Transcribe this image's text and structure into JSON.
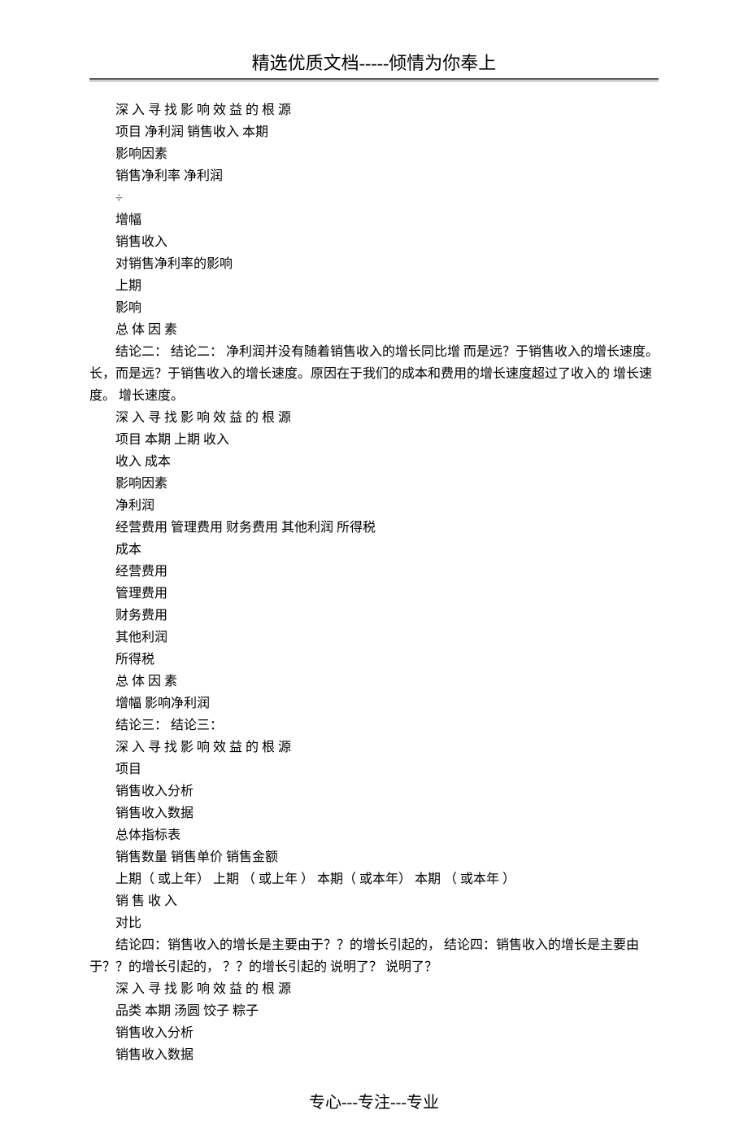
{
  "header": "精选优质文档-----倾情为你奉上",
  "footer": "专心---专注---专业",
  "lines": [
    "深 入 寻 找 影 响 效 益 的 根 源",
    "项目  净利润  销售收入  本期",
    "影响因素",
    "销售净利率  净利润",
    "÷",
    "增幅",
    "销售收入",
    "对销售净利率的影响",
    "上期",
    "影响",
    "总 体 因 素"
  ],
  "conclusion2": "结论二：  结论二：  净利润并没有随着销售收入的增长同比增 而是远？于销售收入的增长速度。长，而是远？于销售收入的增长速度。原因在于我们的成本和费用的增长速度超过了收入的 增长速度。 增长速度。",
  "lines2": [
    "深 入 寻 找 影 响 效 益 的 根 源",
    "项目  本期  上期  收入",
    "收入 成本",
    "影响因素",
    "净利润",
    "经营费用 管理费用 财务费用 其他利润 所得税",
    "成本",
    "经营费用",
    "管理费用",
    "财务费用",
    "其他利润",
    "所得税",
    "总 体 因 素",
    "增幅 影响净利润",
    "结论三：  结论三：",
    "深 入 寻 找 影 响 效 益 的 根 源",
    "项目",
    "销售收入分析",
    "销售收入数据",
    "总体指标表",
    "销售数量 销售单价 销售金额",
    "上期（ 或上年）  上期 （ 或上年 ）  本期（ 或本年）  本期 （ 或本年 ）",
    "销 售 收 入",
    "对比"
  ],
  "conclusion4": "结论四：销售收入的增长是主要由于？？的增长引起的，  结论四：销售收入的增长是主要由于？？的增长引起的，  ？？的增长引起的 说明了？  说明了？",
  "lines3": [
    "深 入 寻 找 影 响 效 益 的 根 源",
    "品类  本期  汤圆  饺子  粽子",
    "销售收入分析",
    "销售收入数据"
  ]
}
